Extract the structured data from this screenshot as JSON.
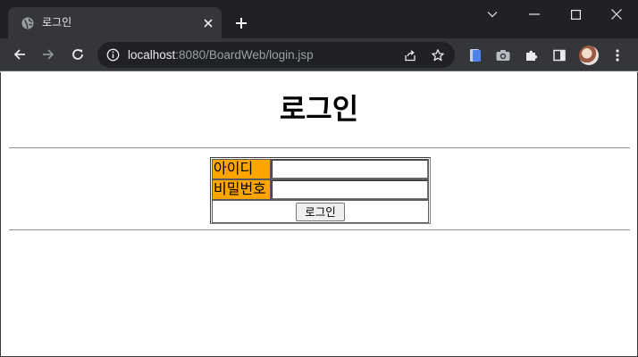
{
  "browser": {
    "tab_title": "로그인",
    "url_host": "localhost",
    "url_rest": ":8080/BoardWeb/login.jsp",
    "accent": "#202124",
    "toolbar_color": "#35363a"
  },
  "page": {
    "title": "로그인",
    "form": {
      "id_label": "아이디",
      "id_value": "",
      "password_label": "비밀번호",
      "password_value": "",
      "submit_label": "로그인",
      "label_color": "#ffa500"
    }
  },
  "icons": {
    "favicon": "globe-icon",
    "tab_close": "close-icon",
    "new_tab": "plus-icon",
    "back": "back-arrow-icon",
    "forward": "forward-arrow-icon",
    "reload": "reload-icon",
    "site_info": "info-icon",
    "share": "share-icon",
    "bookmark": "star-icon",
    "extension_1": "document-extension-icon",
    "extension_2": "camera-extension-icon",
    "extensions": "puzzle-icon",
    "side_panel": "side-panel-icon",
    "profile": "avatar",
    "menu": "kebab-menu-icon",
    "tab_search": "chevron-down-icon",
    "minimize": "minimize-icon",
    "maximize": "maximize-icon",
    "close_window": "close-window-icon"
  }
}
